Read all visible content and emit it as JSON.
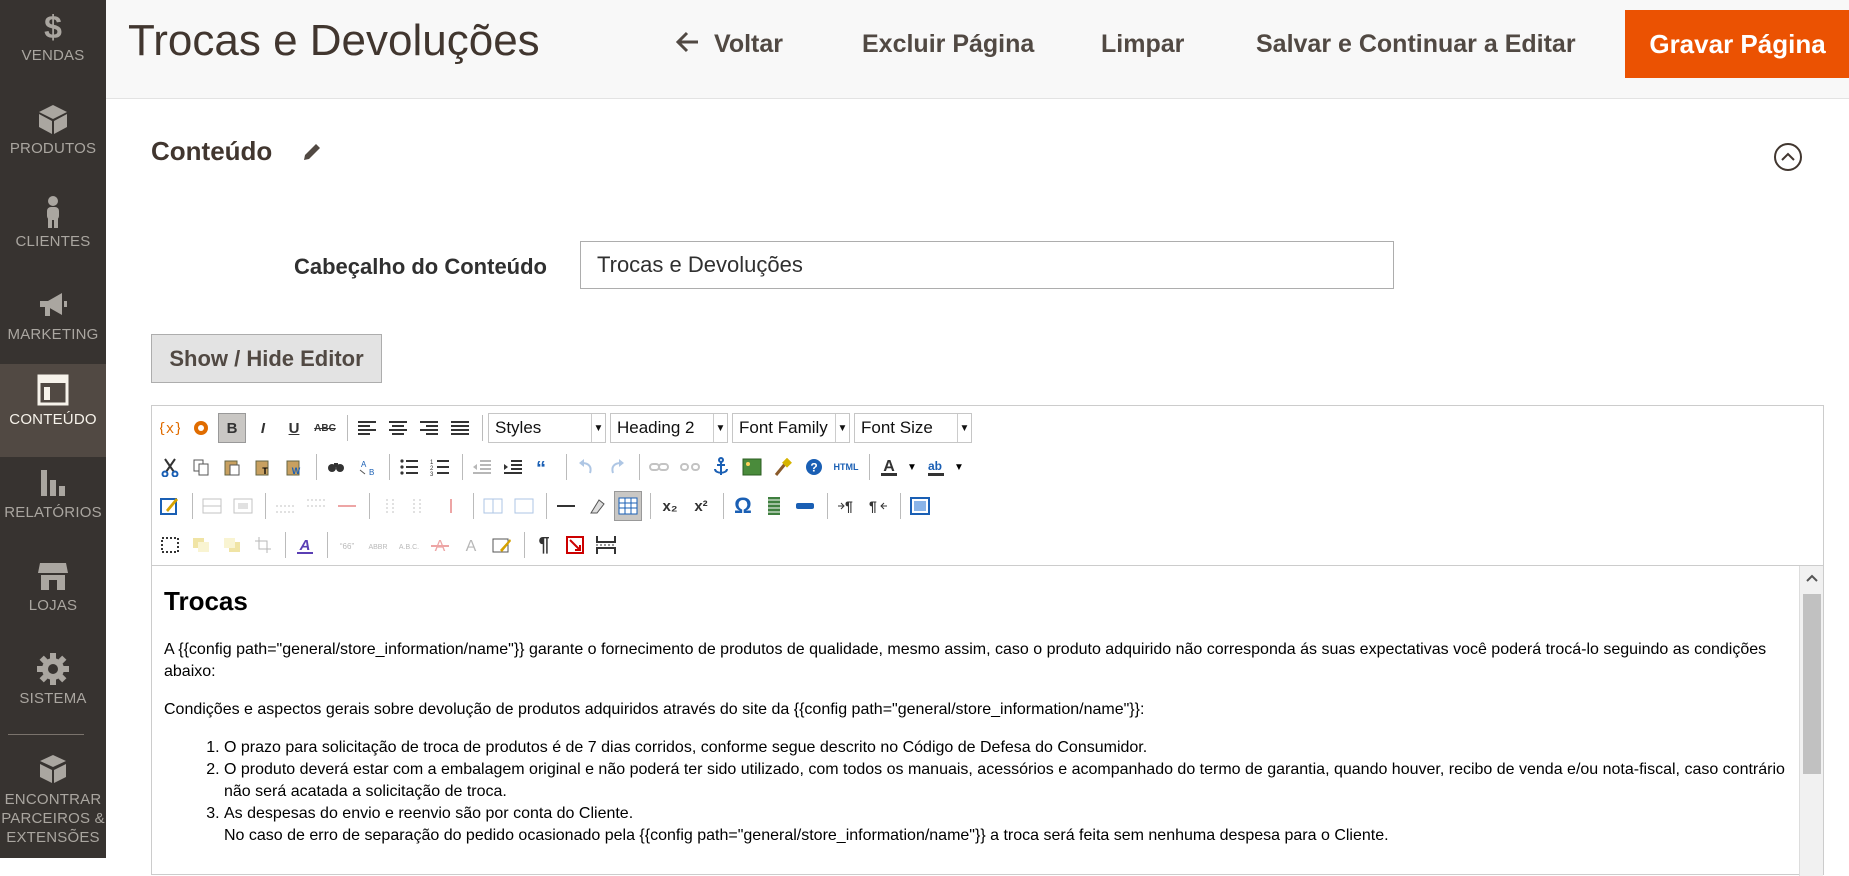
{
  "sidebar": {
    "items": [
      {
        "label": "VENDAS",
        "icon": "dollar-icon"
      },
      {
        "label": "PRODUTOS",
        "icon": "box-icon"
      },
      {
        "label": "CLIENTES",
        "icon": "person-icon"
      },
      {
        "label": "MARKETING",
        "icon": "megaphone-icon"
      },
      {
        "label": "CONTEÚDO",
        "icon": "layout-icon",
        "active": true
      },
      {
        "label": "RELATÓRIOS",
        "icon": "bar-chart-icon"
      },
      {
        "label": "LOJAS",
        "icon": "store-icon"
      },
      {
        "label": "SISTEMA",
        "icon": "gear-icon"
      },
      {
        "label": "ENCONTRAR PARCEIROS & EXTENSÕES",
        "icon": "blocks-icon"
      }
    ]
  },
  "header": {
    "title": "Trocas e Devoluções",
    "back_label": "Voltar",
    "delete_label": "Excluir Página",
    "reset_label": "Limpar",
    "save_continue_label": "Salvar e Continuar a Editar",
    "save_label": "Gravar Página",
    "accent_color": "#eb5202"
  },
  "section": {
    "title": "Conteúdo",
    "heading_label": "Cabeçalho do Conteúdo",
    "heading_value": "Trocas e Devoluções",
    "toggle_editor_label": "Show / Hide Editor"
  },
  "toolbar": {
    "styles": "Styles",
    "format": "Heading 2",
    "font_family": "Font Family",
    "font_size": "Font Size",
    "bold": "B",
    "italic": "I",
    "underline": "U",
    "strike": "ABC",
    "html": "HTML",
    "omega": "Ω",
    "pilcrow": "¶",
    "sub": "x₂",
    "sup": "x²"
  },
  "editor_content": {
    "heading": "Trocas",
    "paragraph1": "A {{config path=\"general/store_information/name\"}} garante o fornecimento de produtos de qualidade, mesmo assim, caso o produto adquirido não corresponda ás suas expectativas você poderá trocá-lo seguindo as condições abaixo:",
    "paragraph2": "Condições e aspectos gerais sobre devolução de produtos adquiridos através do site da {{config path=\"general/store_information/name\"}}:",
    "list": [
      "O prazo para solicitação de troca de produtos é de 7 dias corridos, conforme segue descrito no Código de Defesa do Consumidor.",
      "O produto deverá estar com a embalagem original e não poderá ter sido utilizado, com todos os manuais, acessórios e acompanhado do termo de garantia, quando houver, recibo de venda e/ou nota-fiscal, caso contrário não será acatada a solicitação de troca.",
      "As despesas do envio e reenvio são por conta do Cliente."
    ],
    "list_item3_extra": "No caso de erro de separação do pedido ocasionado pela {{config path=\"general/store_information/name\"}} a troca será feita sem nenhuma despesa para o Cliente."
  }
}
